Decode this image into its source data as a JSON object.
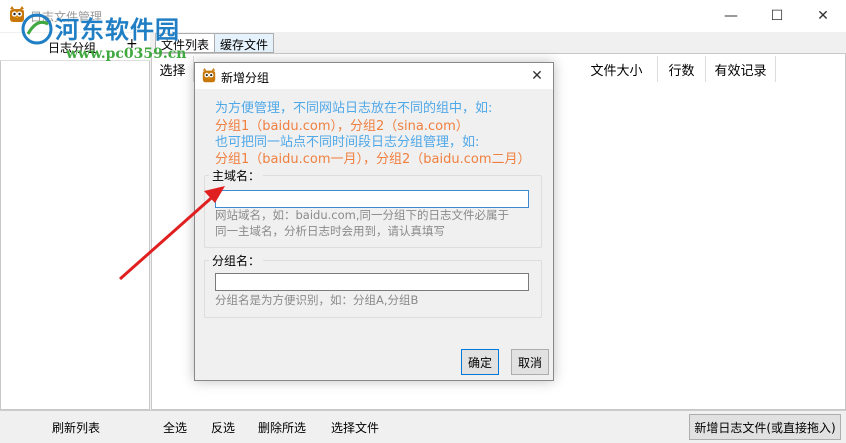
{
  "window": {
    "title": "日志文件管理",
    "minimize_glyph": "—",
    "maximize_glyph": "☐",
    "close_glyph": "✕"
  },
  "left_panel": {
    "header_label": "日志分组",
    "add_glyph": "+",
    "refresh_label": "刷新列表"
  },
  "tabs": [
    {
      "label": "文件列表"
    },
    {
      "label": "缓存文件"
    }
  ],
  "columns": [
    "选择",
    "文件大小",
    "行数",
    "有效记录"
  ],
  "bottom": {
    "select_all": "全选",
    "invert": "反选",
    "delete_selected": "删除所选",
    "choose_file": "选择文件",
    "add_log_file": "新增日志文件(或直接拖入)"
  },
  "watermark": {
    "name": "河东软件园",
    "url": "www.pc0359.cn"
  },
  "dialog": {
    "title": "新增分组",
    "close_glyph": "✕",
    "info_lines": [
      "为方便管理，不同网站日志放在不同的组中，如:",
      "分组1（baidu.com），分组2（sina.com）",
      "也可把同一站点不同时间段日志分组管理，如:",
      "分组1（baidu.com一月），分组2（baidu.com二月）"
    ],
    "domain_group": {
      "legend": "主域名：",
      "value": "",
      "hint_lines": [
        "网站域名，如：baidu.com,同一分组下的日志文件必属于",
        "同一主域名，分析日志时会用到，请认真填写"
      ]
    },
    "name_group": {
      "legend": "分组名：",
      "value": "",
      "hint": "分组名是为方便识别，如：分组A,分组B"
    },
    "ok_label": "确定",
    "cancel_label": "取消"
  },
  "colors": {
    "info_blue": "#4fa8e8",
    "info_orange": "#f08040",
    "arrow_red": "#e02020",
    "watermark_blue": "#1f7ec4",
    "watermark_green": "#3fa83f"
  }
}
